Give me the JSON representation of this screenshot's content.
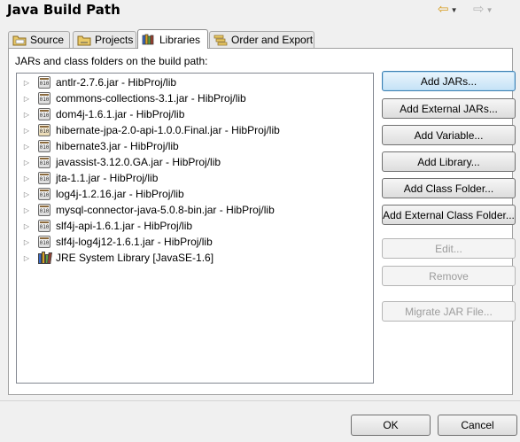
{
  "dialog": {
    "title": "Java Build Path",
    "nav": {
      "back_icon": "yellow-left-arrow-icon",
      "forward_icon": "gray-right-arrow-icon"
    }
  },
  "tabs": [
    {
      "label": "Source",
      "icon": "source-folder-icon",
      "active": false
    },
    {
      "label": "Projects",
      "icon": "projects-icon",
      "active": false
    },
    {
      "label": "Libraries",
      "icon": "libraries-icon",
      "active": true
    },
    {
      "label": "Order and Export",
      "icon": "order-export-icon",
      "active": false
    }
  ],
  "libraries": {
    "label": "JARs and class folders on the build path:",
    "items": [
      {
        "name": "antlr-2.7.6.jar - HibProj/lib",
        "icon": "jar-icon"
      },
      {
        "name": "commons-collections-3.1.jar - HibProj/lib",
        "icon": "jar-icon"
      },
      {
        "name": "dom4j-1.6.1.jar - HibProj/lib",
        "icon": "jar-icon"
      },
      {
        "name": "hibernate-jpa-2.0-api-1.0.0.Final.jar - HibProj/lib",
        "icon": "jar-icon"
      },
      {
        "name": "hibernate3.jar - HibProj/lib",
        "icon": "jar-icon"
      },
      {
        "name": "javassist-3.12.0.GA.jar - HibProj/lib",
        "icon": "jar-icon"
      },
      {
        "name": "jta-1.1.jar - HibProj/lib",
        "icon": "jar-icon"
      },
      {
        "name": "log4j-1.2.16.jar - HibProj/lib",
        "icon": "jar-icon"
      },
      {
        "name": "mysql-connector-java-5.0.8-bin.jar - HibProj/lib",
        "icon": "jar-icon"
      },
      {
        "name": "slf4j-api-1.6.1.jar - HibProj/lib",
        "icon": "jar-icon"
      },
      {
        "name": "slf4j-log4j12-1.6.1.jar - HibProj/lib",
        "icon": "jar-icon"
      },
      {
        "name": "JRE System Library [JavaSE-1.6]",
        "icon": "library-books-icon"
      }
    ]
  },
  "buttons": {
    "add_jars": "Add JARs...",
    "add_external_jars": "Add External JARs...",
    "add_variable": "Add Variable...",
    "add_library": "Add Library...",
    "add_class_folder": "Add Class Folder...",
    "add_external_class_folder": "Add External Class Folder...",
    "edit": "Edit...",
    "remove": "Remove",
    "migrate_jar": "Migrate JAR File..."
  },
  "footer": {
    "ok": "OK",
    "cancel": "Cancel"
  }
}
